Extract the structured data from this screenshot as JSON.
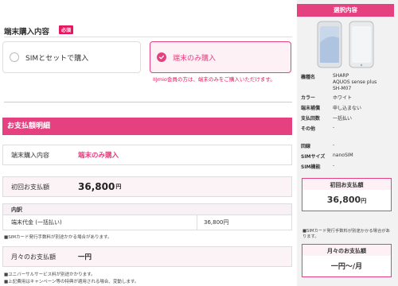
{
  "purchase": {
    "title": "端末購入内容",
    "required_badge": "必須",
    "options": [
      {
        "label": "SIMとセットで購入",
        "selected": false
      },
      {
        "label": "端末のみ購入",
        "selected": true
      }
    ],
    "iimio_note": "IIJmio会員の方は、端末のみをご購入いただけます。"
  },
  "payment": {
    "header": "お支払額明細",
    "purchase_label": "端末購入内容",
    "purchase_value": "端末のみ購入",
    "first_label": "初回お支払額",
    "first_value": "36,800",
    "first_unit": "円",
    "breakdown_head": "内訳",
    "breakdown_row_label": "端末代金 (一括払い)",
    "breakdown_row_value": "36,800円",
    "note_sim_fee": "■SIMカード発行手数料が別途かかる場合があります。",
    "monthly_label": "月々のお支払額",
    "monthly_value": "一円",
    "note_universal": "■ユニバーサルサービス料が別途かかります。",
    "note_campaign": "■上記費用はキャンペーン等の特典が適用される場合、変動します。"
  },
  "sidebar": {
    "header": "選択内容",
    "specs": [
      {
        "k": "機種名",
        "v": "SHARP\nAQUOS sense plus\nSH-M07"
      },
      {
        "k": "カラー",
        "v": "ホワイト"
      },
      {
        "k": "端末補償",
        "v": "申し込まない"
      },
      {
        "k": "支払回数",
        "v": "一括払い"
      },
      {
        "k": "その他",
        "v": "-"
      },
      {
        "k": "回線",
        "v": "-"
      },
      {
        "k": "SIMサイズ",
        "v": "nanoSIM"
      },
      {
        "k": "SIM機能",
        "v": "-"
      }
    ],
    "first_label": "初回お支払額",
    "first_value": "36,800",
    "first_unit": "円",
    "sim_note": "■SIMカード発行手数料が別途かかる場合があります。",
    "monthly_label": "月々のお支払額",
    "monthly_value": "一円〜/月"
  },
  "colors": {
    "accent": "#e5407f",
    "accent_dark": "#e5185f"
  }
}
